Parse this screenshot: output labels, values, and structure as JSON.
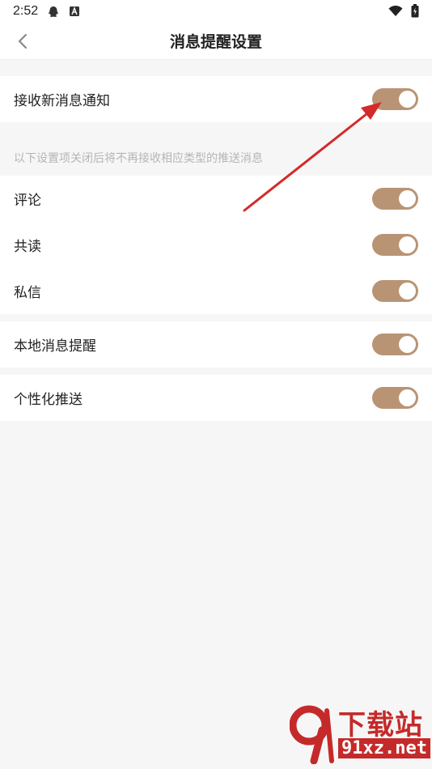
{
  "status_bar": {
    "time": "2:52",
    "icons": [
      "qq-icon",
      "notification-a-icon",
      "wifi-icon",
      "battery-icon"
    ]
  },
  "header": {
    "title": "消息提醒设置",
    "back_icon": "chevron-left-icon"
  },
  "main_toggle": {
    "label": "接收新消息通知",
    "on": true
  },
  "hint": "以下设置项关闭后将不再接收相应类型的推送消息",
  "type_toggles": [
    {
      "label": "评论",
      "on": true
    },
    {
      "label": "共读",
      "on": true
    },
    {
      "label": "私信",
      "on": true
    }
  ],
  "local_toggle": {
    "label": "本地消息提醒",
    "on": true
  },
  "personal_toggle": {
    "label": "个性化推送",
    "on": true
  },
  "colors": {
    "switch_on": "#b99474",
    "arrow": "#d42a2a",
    "background": "#f6f6f6"
  },
  "watermark": {
    "brand": "下载站",
    "site": "91xz.net",
    "logo_text": "9"
  }
}
